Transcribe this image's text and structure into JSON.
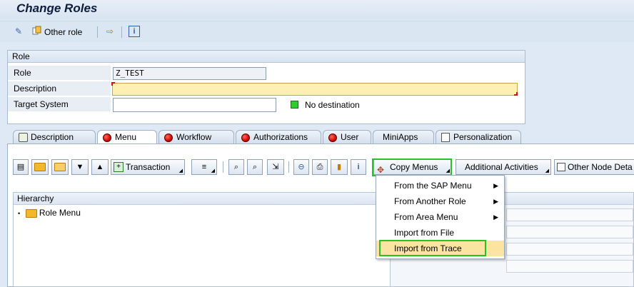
{
  "window": {
    "title": "Change Roles"
  },
  "app_toolbar": {
    "other_role_label": "Other role",
    "icons": [
      "display-change-icon",
      "other-role-icon",
      "transport-icon",
      "info-icon"
    ]
  },
  "role_group": {
    "title": "Role",
    "fields": {
      "role_label": "Role",
      "role_value": "Z_TEST",
      "description_label": "Description",
      "description_value": "",
      "target_system_label": "Target System",
      "target_system_value": "",
      "status_text": "No destination"
    }
  },
  "tabs": [
    {
      "label": "Description",
      "status": "none"
    },
    {
      "label": "Menu",
      "status": "red",
      "active": true
    },
    {
      "label": "Workflow",
      "status": "red"
    },
    {
      "label": "Authorizations",
      "status": "red"
    },
    {
      "label": "User",
      "status": "red"
    },
    {
      "label": "MiniApps",
      "status": "none"
    },
    {
      "label": "Personalization",
      "status": "none"
    }
  ],
  "menu_toolbar": {
    "transaction_label": "Transaction",
    "copy_menus_label": "Copy Menus",
    "additional_activities_label": "Additional Activities",
    "other_node_details_label": "Other Node Deta"
  },
  "hierarchy": {
    "header": "Hierarchy",
    "root_node": "Role Menu"
  },
  "copy_menus_dropdown": {
    "items": [
      {
        "label": "From the SAP Menu",
        "submenu": true
      },
      {
        "label": "From Another Role",
        "submenu": true
      },
      {
        "label": "From Area Menu",
        "submenu": true
      },
      {
        "label": "Import from File",
        "submenu": false
      },
      {
        "label": "Import from Trace",
        "submenu": false,
        "highlighted": true
      }
    ]
  },
  "colors": {
    "status_green": "#2ecc2e",
    "status_red": "#d40000",
    "highlight_frame": "#27c227",
    "required_field_bg": "#fdf0b0"
  }
}
